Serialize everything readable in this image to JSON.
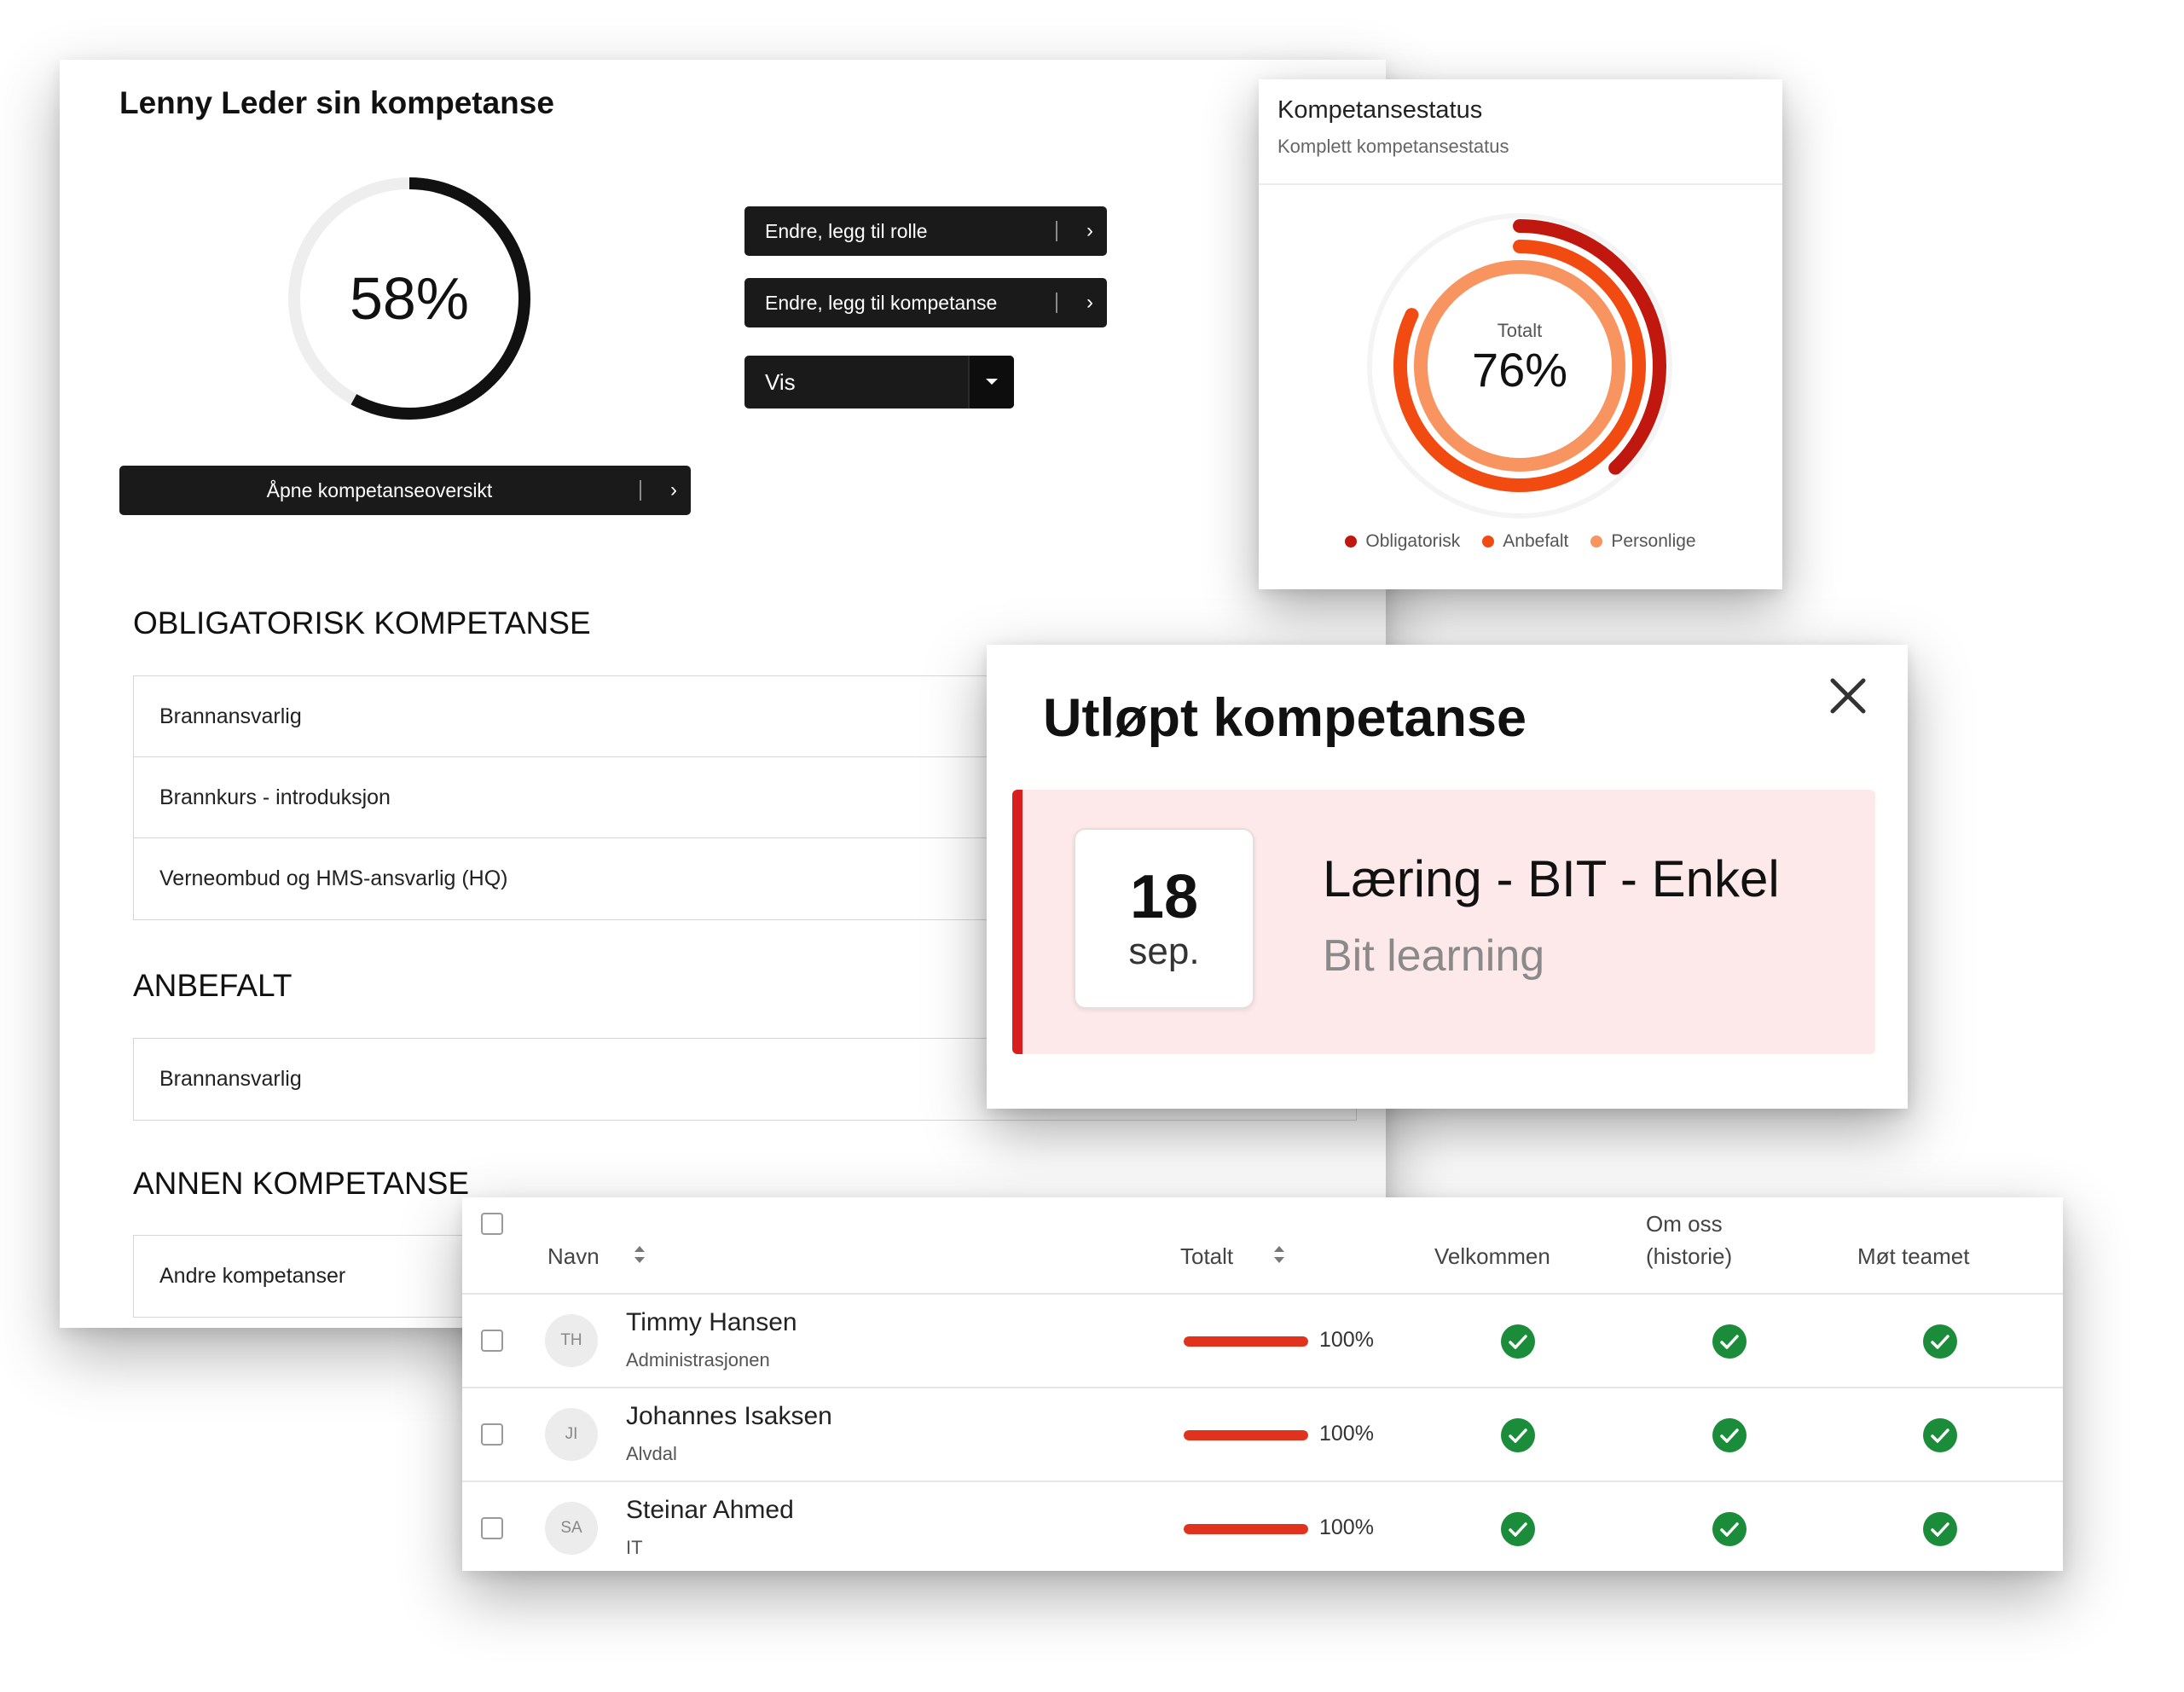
{
  "colors": {
    "dark_button": "#1a1a1a",
    "ring_main": "#111111",
    "ring_track": "#eeeeee",
    "obligatorisk": "#c0180e",
    "anbefalt": "#f24b12",
    "personlige": "#f79460",
    "expired_bg": "#fde9e9",
    "expired_accent": "#d81e1e",
    "progress_bar": "#e0321c",
    "check_green": "#1a8c3a"
  },
  "main": {
    "title": "Lenny Leder sin kompetanse",
    "progress_percent": 58,
    "progress_label": "58%",
    "buttons": {
      "edit_role": "Endre, legg til rolle",
      "edit_competence": "Endre, legg til kompetanse",
      "open_overview": "Åpne kompetanseoversikt"
    },
    "vis_select": {
      "selected": "Vis"
    },
    "sections": [
      {
        "heading": "OBLIGATORISK KOMPETANSE",
        "items": [
          "Brannansvarlig",
          "Brannkurs - introduksjon",
          "Verneombud og HMS-ansvarlig (HQ)"
        ]
      },
      {
        "heading": "ANBEFALT",
        "items": [
          "Brannansvarlig"
        ]
      },
      {
        "heading": "ANNEN KOMPETANSE",
        "items": [
          "Andre kompetanser"
        ]
      }
    ]
  },
  "status": {
    "title": "Kompetansestatus",
    "subtitle": "Komplett kompetansestatus",
    "center_label": "Totalt",
    "center_value": "76%",
    "rings": [
      {
        "name": "Obligatorisk",
        "percent": 38
      },
      {
        "name": "Anbefalt",
        "percent": 82
      },
      {
        "name": "Personlige",
        "percent": 100
      }
    ],
    "legend": [
      "Obligatorisk",
      "Anbefalt",
      "Personlige"
    ]
  },
  "expired": {
    "title": "Utløpt kompetanse",
    "item": {
      "day": "18",
      "month": "sep.",
      "course": "Læring - BIT - Enkel",
      "provider": "Bit learning"
    }
  },
  "table": {
    "headers": {
      "name": "Navn",
      "total": "Totalt",
      "col1": "Velkommen",
      "col2_line1": "Om oss",
      "col2_line2": "(historie)",
      "col3": "Møt teamet"
    },
    "rows": [
      {
        "initials": "TH",
        "name": "Timmy Hansen",
        "dept": "Administrasjonen",
        "percent": 100,
        "percent_label": "100%"
      },
      {
        "initials": "JI",
        "name": "Johannes Isaksen",
        "dept": "Alvdal",
        "percent": 100,
        "percent_label": "100%"
      },
      {
        "initials": "SA",
        "name": "Steinar Ahmed",
        "dept": "IT",
        "percent": 100,
        "percent_label": "100%"
      }
    ]
  }
}
